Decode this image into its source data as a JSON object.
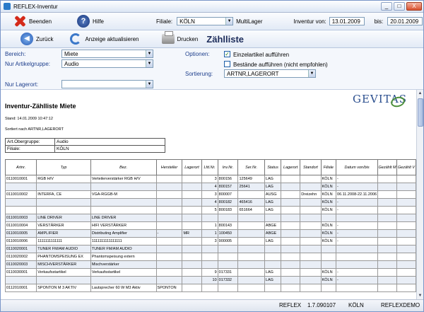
{
  "window": {
    "title": "REFLEX-Inventur",
    "min": "_",
    "max": "□",
    "close": "X"
  },
  "toolbar1": {
    "beenden": "Beenden",
    "hilfe": "Hilfe",
    "filiale_label": "Filiale:",
    "filiale_value": "KÖLN",
    "multilager": "MultiLager",
    "inventur_von_label": "Inventur von:",
    "inventur_von": "13.01.2009",
    "bis_label": "bis:",
    "bis": "20.01.2009"
  },
  "toolbar2": {
    "zurueck": "Zurück",
    "aktualisieren": "Anzeige aktualisieren",
    "drucken": "Drucken",
    "heading": "Zählliste"
  },
  "filters": {
    "bereich_label": "Bereich:",
    "bereich_value": "Miete",
    "artikelgruppe_label": "Nur Artikelgruppe:",
    "artikelgruppe_value": "Audio",
    "lagerort_label": "Nur Lagerort:",
    "lagerort_value": "",
    "optionen_label": "Optionen:",
    "opt1": "Einzelartikel aufführen",
    "opt1_checked": "✓",
    "opt2": "Bestände aufführen (nicht empfohlen)",
    "sortierung_label": "Sortierung:",
    "sortierung_value": "ARTNR,LAGERORT"
  },
  "report": {
    "logo": "GEVITAS",
    "title": "Inventur-Zählliste Miete",
    "stand": "Stand: 14.01.2009 10:47:12",
    "sortiert": "Sortiert nach ARTNR,LAGERORT",
    "info": [
      {
        "label": "Art.Obergruppe:",
        "value": "Audio"
      },
      {
        "label": "Filiale:",
        "value": "KÖLN"
      }
    ],
    "columns": [
      "Artnr.",
      "Typ",
      "Bez.",
      "Hersteller",
      "Lagerort",
      "Lfd.Nr.",
      "Inv.Nr.",
      "Ser.Nr.",
      "Status",
      "Lagerort",
      "Standort",
      "Filiale",
      "Datum von/bis",
      "Gezählt M",
      "Gezählt V"
    ],
    "rows": [
      [
        "0110010001",
        "RGB H/V",
        "Verteilerverstärker RGB H/V",
        "",
        "",
        "3",
        "800156",
        "125649",
        "LAG",
        "",
        "",
        "KÖLN",
        "-",
        "",
        ""
      ],
      [
        "",
        "",
        "",
        "",
        "",
        "4",
        "800157",
        "25641",
        "LAG",
        "",
        "",
        "KÖLN",
        "-",
        "",
        ""
      ],
      [
        "0110010002",
        "INTERFA, CE",
        "VGA-RGGB-M",
        "",
        "",
        "3",
        "800007",
        "",
        "AUSG",
        "",
        "Dreizehn",
        "KÖLN",
        "06.11.2008-22.11.2006",
        "",
        ""
      ],
      [
        "",
        "",
        "",
        "",
        "",
        "4",
        "800182",
        "465416",
        "LAG",
        "",
        "",
        "KÖLN",
        "-",
        "",
        ""
      ],
      [
        "",
        "",
        "",
        "",
        "",
        "5",
        "800183",
        "651664",
        "LAG",
        "",
        "",
        "KÖLN",
        "-",
        "",
        ""
      ],
      [
        "0110010003",
        "LINE DRIVER",
        "LINE DRIVER",
        "",
        "",
        "",
        "",
        "",
        "",
        "",
        "",
        "",
        "",
        "",
        ""
      ],
      [
        "0110010004",
        "VERSTÄRKER",
        "HIFI VERSTÄRKER",
        "",
        "",
        "1",
        "800143",
        "",
        "ABGE",
        "",
        "",
        "KÖLN",
        "-",
        "",
        ""
      ],
      [
        "0110010005",
        "AMPLIFIER",
        "Distributing Amplifier",
        "-",
        "MR",
        "1",
        "100450",
        "",
        "ABGE",
        "",
        "",
        "KÖLN",
        "-",
        "",
        ""
      ],
      [
        "0110010006",
        "1111111111111",
        "1111111111111111",
        "",
        "",
        "3",
        "900005",
        "",
        "LAG",
        "",
        "",
        "KÖLN",
        "-",
        "",
        ""
      ],
      [
        "0110020001",
        "TUNER FM/AM AUDIO",
        "TUNER FM/AM AUDIO",
        "",
        "",
        "",
        "",
        "",
        "",
        "",
        "",
        "",
        "",
        "",
        ""
      ],
      [
        "0110020002",
        "PHANTOMSPEISUNG EX",
        "Phantomspeisung extern",
        "",
        "",
        "",
        "",
        "",
        "",
        "",
        "",
        "",
        "",
        "",
        ""
      ],
      [
        "0110020003",
        "MISCHVERSTÄRKER",
        "Mischverstärker",
        "",
        "",
        "",
        "",
        "",
        "",
        "",
        "",
        "",
        "",
        "",
        ""
      ],
      [
        "0110030001",
        "Verkaufsstartikel",
        "Verkaufsstartikel",
        "",
        "",
        "9",
        "017331",
        "",
        "LAG",
        "",
        "",
        "KÖLN",
        "-",
        "",
        ""
      ],
      [
        "",
        "",
        "",
        "",
        "",
        "10",
        "017332",
        "",
        "LAG",
        "",
        "",
        "KÖLN",
        "-",
        "",
        ""
      ],
      [
        "0112010001",
        "SPONTON M 3 AKTIV",
        "Lautsprecher 60 W M3 Aktiv",
        "SPONTON",
        "",
        "",
        "",
        "",
        "",
        "",
        "",
        "",
        "",
        "",
        ""
      ]
    ]
  },
  "status": {
    "app": "REFLEX",
    "version": "1.7.090107",
    "filiale": "KÖLN",
    "user": "REFLEXDEMO"
  }
}
